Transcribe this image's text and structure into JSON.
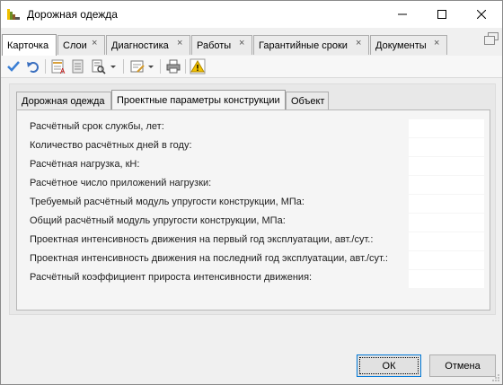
{
  "window": {
    "title": "Дорожная одежда"
  },
  "tabs": [
    {
      "label": "Карточка",
      "active": true
    },
    {
      "label": "Слои"
    },
    {
      "label": "Диагностика"
    },
    {
      "label": "Работы"
    },
    {
      "label": "Гарантийные сроки"
    },
    {
      "label": "Документы"
    }
  ],
  "toolbar": {
    "icons": [
      "checkmark-icon",
      "undo-icon",
      "report-icon",
      "document-icon",
      "print-preview-icon",
      "dropdown-arrow-icon",
      "form-edit-icon",
      "dropdown-arrow-icon",
      "printer-icon",
      "warning-icon"
    ]
  },
  "inner_tabs": [
    {
      "label": "Дорожная одежда"
    },
    {
      "label": "Проектные параметры конструкции",
      "active": true
    },
    {
      "label": "Объект"
    }
  ],
  "fields": [
    {
      "label": "Расчётный срок службы, лет:",
      "value": ""
    },
    {
      "label": "Количество расчётных дней в году:",
      "value": ""
    },
    {
      "label": "Расчётная нагрузка, кН:",
      "value": ""
    },
    {
      "label": "Расчётное число приложений нагрузки:",
      "value": ""
    },
    {
      "label": "Требуемый расчётный модуль упругости конструкции, МПа:",
      "value": ""
    },
    {
      "label": "Общий расчётный модуль упругости конструкции, МПа:",
      "value": ""
    },
    {
      "label": "Проектная интенсивность движения на первый год эксплуатации, авт./сут.:",
      "value": ""
    },
    {
      "label": "Проектная интенсивность движения на последний год эксплуатации, авт./сут.:",
      "value": ""
    },
    {
      "label": "Расчётный коэффициент прироста интенсивности движения:",
      "value": ""
    }
  ],
  "buttons": {
    "ok": "ОК",
    "cancel": "Отмена"
  },
  "colors": {
    "focus_border": "#0078d7",
    "accent_check": "#3a7fd5",
    "warning": "#f2c200"
  }
}
